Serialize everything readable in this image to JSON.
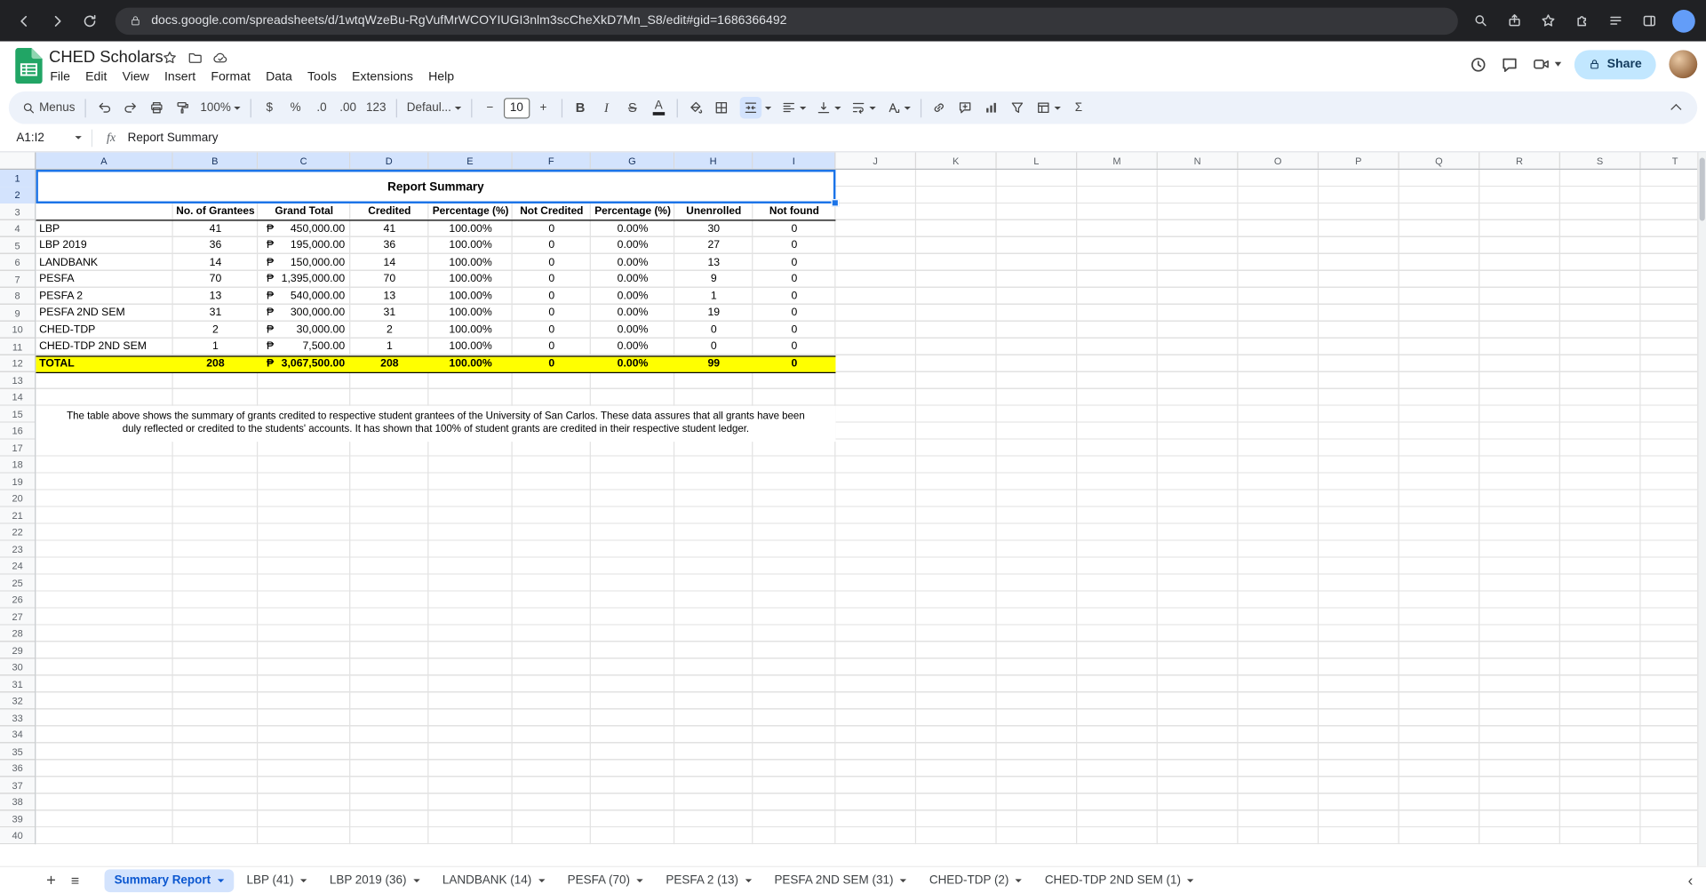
{
  "browser": {
    "url": "docs.google.com/spreadsheets/d/1wtqWzeBu-RgVufMrWCOYIUGI3nlm3scCheXkD7Mn_S8/edit#gid=1686366492"
  },
  "header": {
    "title": "CHED Scholars",
    "menus": [
      "File",
      "Edit",
      "View",
      "Insert",
      "Format",
      "Data",
      "Tools",
      "Extensions",
      "Help"
    ],
    "share_label": "Share"
  },
  "toolbar": {
    "menus_label": "Menus",
    "zoom": "100%",
    "currency": "$",
    "percent": "%",
    "dec_decrease": ".0",
    "dec_increase": ".00",
    "more_formats": "123",
    "font_family": "Defaul...",
    "font_size": "10",
    "bold": "B",
    "italic": "I",
    "strikethrough": "S",
    "text_color": "A",
    "sum": "Σ"
  },
  "formula_bar": {
    "name_box": "A1:I2",
    "fx": "fx",
    "value": "Report Summary"
  },
  "grid": {
    "columns": [
      "A",
      "B",
      "C",
      "D",
      "E",
      "F",
      "G",
      "H",
      "I",
      "J",
      "K",
      "L",
      "M",
      "N",
      "O",
      "P",
      "Q",
      "R",
      "S",
      "T"
    ],
    "rows_visible": 40,
    "selection_range": "A1:I2"
  },
  "sheet": {
    "title": "Report Summary",
    "currency_symbol": "₱",
    "headers": [
      "No. of Grantees",
      "Grand Total",
      "Credited",
      "Percentage (%)",
      "Not Credited",
      "Percentage (%)",
      "Unenrolled",
      "Not found"
    ],
    "rows": [
      [
        "LBP",
        "41",
        "450,000.00",
        "41",
        "100.00%",
        "0",
        "0.00%",
        "30",
        "0"
      ],
      [
        "LBP 2019",
        "36",
        "195,000.00",
        "36",
        "100.00%",
        "0",
        "0.00%",
        "27",
        "0"
      ],
      [
        "LANDBANK",
        "14",
        "150,000.00",
        "14",
        "100.00%",
        "0",
        "0.00%",
        "13",
        "0"
      ],
      [
        "PESFA",
        "70",
        "1,395,000.00",
        "70",
        "100.00%",
        "0",
        "0.00%",
        "9",
        "0"
      ],
      [
        "PESFA 2",
        "13",
        "540,000.00",
        "13",
        "100.00%",
        "0",
        "0.00%",
        "1",
        "0"
      ],
      [
        "PESFA 2ND SEM",
        "31",
        "300,000.00",
        "31",
        "100.00%",
        "0",
        "0.00%",
        "19",
        "0"
      ],
      [
        "CHED-TDP",
        "2",
        "30,000.00",
        "2",
        "100.00%",
        "0",
        "0.00%",
        "0",
        "0"
      ],
      [
        "CHED-TDP 2ND SEM",
        "1",
        "7,500.00",
        "1",
        "100.00%",
        "0",
        "0.00%",
        "0",
        "0"
      ]
    ],
    "total": [
      "TOTAL",
      "208",
      "3,067,500.00",
      "208",
      "100.00%",
      "0",
      "0.00%",
      "99",
      "0"
    ],
    "note_lines": [
      "The table above shows the summary of grants credited to respective student grantees of the University of San Carlos. These data assures that all grants have been",
      "duly reflected or credited to the students' accounts. It has shown that 100% of student grants are credited in their respective student ledger."
    ]
  },
  "tabs": {
    "active": "Summary Report",
    "items": [
      "Summary Report",
      "LBP (41)",
      "LBP 2019 (36)",
      "LANDBANK (14)",
      "PESFA (70)",
      "PESFA 2 (13)",
      "PESFA 2ND SEM (31)",
      "CHED-TDP (2)",
      "CHED-TDP 2ND SEM (1)"
    ]
  }
}
